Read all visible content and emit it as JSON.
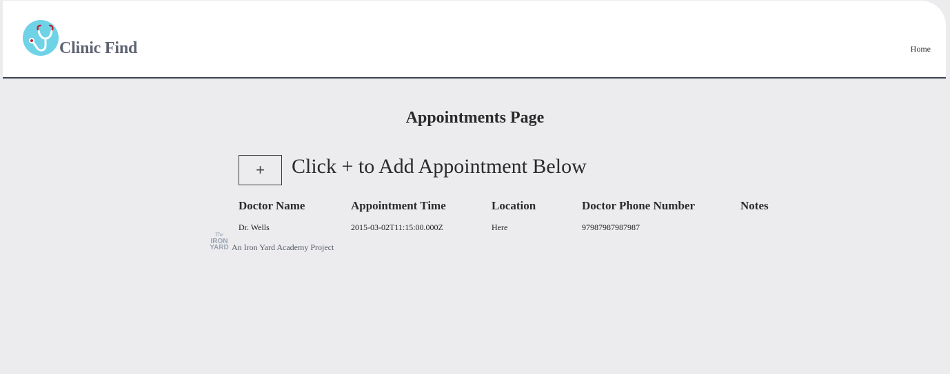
{
  "header": {
    "brand": "Clinic Find",
    "nav": {
      "home": "Home"
    },
    "logo_icon": "stethoscope-icon",
    "colors": {
      "logo_circle": "#6fd3e8",
      "stethoscope_red": "#c0242f",
      "header_border": "#3d4150"
    }
  },
  "main": {
    "title": "Appointments Page",
    "add_button_label": "+",
    "add_instruction": "Click + to Add Appointment Below",
    "table": {
      "headers": [
        "Doctor Name",
        "Appointment Time",
        "Location",
        "Doctor Phone Number",
        "Notes"
      ],
      "rows": [
        [
          "Dr. Wells",
          "2015-03-02T11:15:00.000Z",
          "Here",
          "97987987987987",
          ""
        ]
      ]
    }
  },
  "footer": {
    "logo_text": {
      "the": "The",
      "iron": "IRON",
      "yard": "YARD"
    },
    "text": "An Iron Yard Academy Project"
  }
}
